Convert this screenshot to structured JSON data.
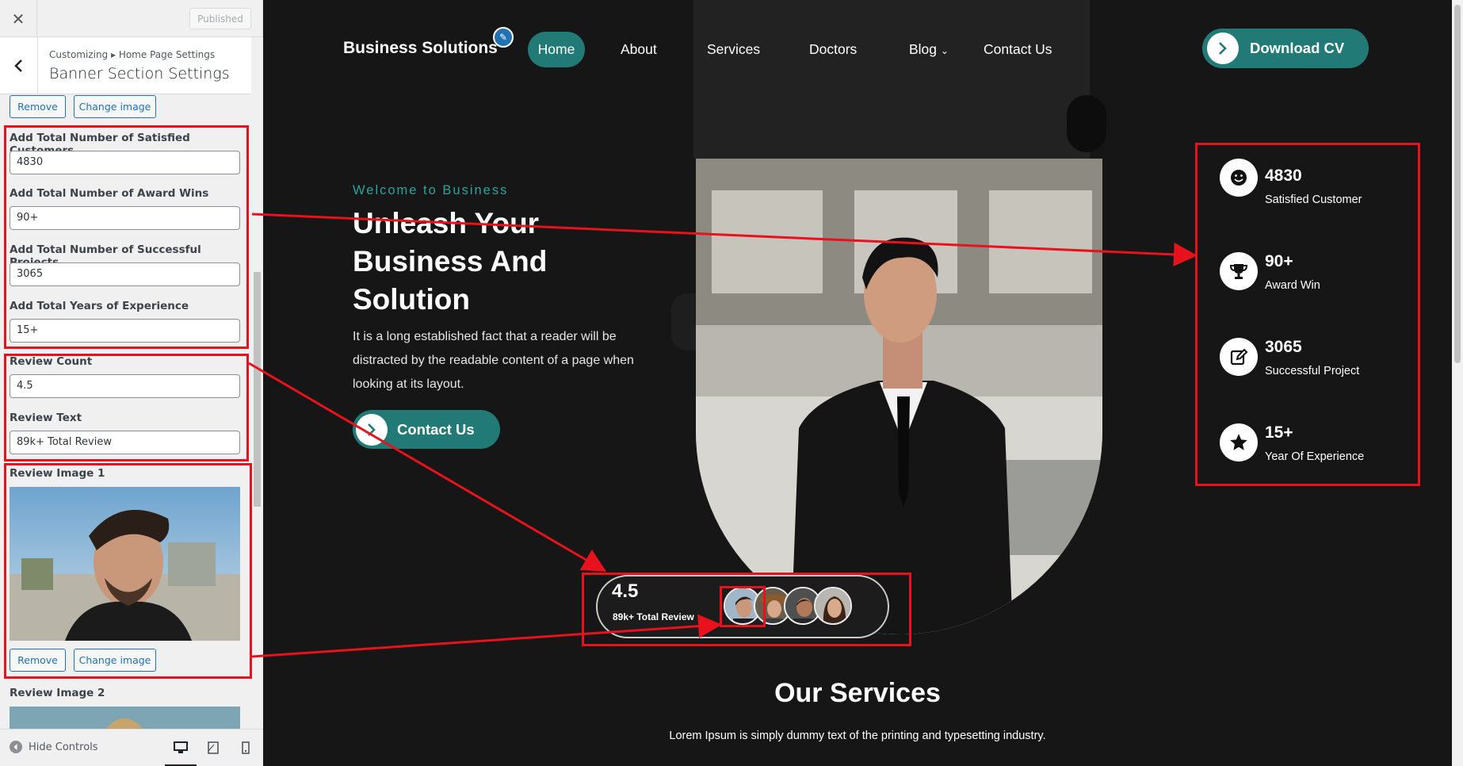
{
  "customizer": {
    "close_label": "✕",
    "publish_label": "Published",
    "breadcrumb": "Customizing ▸ Home Page Settings",
    "section_title": "Banner Section Settings",
    "remove_label": "Remove",
    "change_image_label": "Change image",
    "fields": [
      {
        "label": "Add Total Number of Satisfied Customers",
        "value": "4830"
      },
      {
        "label": "Add Total Number of Award Wins",
        "value": "90+"
      },
      {
        "label": "Add Total Number of Successful Projects",
        "value": "3065"
      },
      {
        "label": "Add Total Years of Experience",
        "value": "15+"
      },
      {
        "label": "Review Count",
        "value": "4.5"
      },
      {
        "label": "Review Text",
        "value": "89k+ Total Review"
      }
    ],
    "review_image_1_label": "Review Image 1",
    "review_image_2_label": "Review Image 2",
    "hide_controls_label": "Hide Controls"
  },
  "site": {
    "logo": "Business Solutions",
    "nav": [
      "Home",
      "About",
      "Services",
      "Doctors",
      "Blog",
      "Contact Us"
    ],
    "download_label": "Download CV",
    "welcome": "Welcome to Business",
    "hero_title": "Unleash Your Business And Solution",
    "hero_desc": "It is a long established fact that a reader will be distracted by the readable content of a page when looking at its layout.",
    "contact_label": "Contact Us",
    "review_count": "4.5",
    "review_text": "89k+ Total Review",
    "stats": [
      {
        "num": "4830",
        "label": "Satisfied Customer",
        "icon": "smile-icon"
      },
      {
        "num": "90+",
        "label": "Award Win",
        "icon": "trophy-icon"
      },
      {
        "num": "3065",
        "label": "Successful Project",
        "icon": "edit-icon"
      },
      {
        "num": "15+",
        "label": "Year Of Experience",
        "icon": "star-icon"
      }
    ],
    "services_title": "Our Services",
    "services_desc": "Lorem Ipsum is simply dummy text of the printing and typesetting industry."
  },
  "colors": {
    "accent": "#217a76",
    "annotation": "#e8121c",
    "wp_blue": "#2271b1"
  }
}
